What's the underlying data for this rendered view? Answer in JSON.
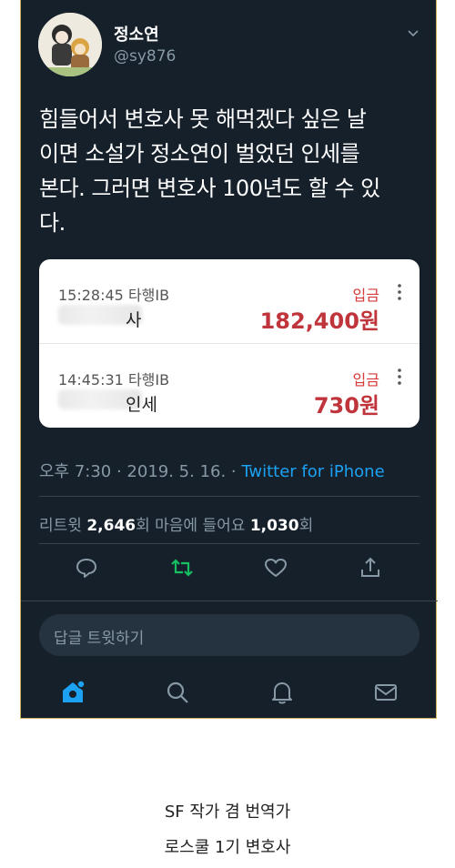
{
  "profile": {
    "display_name": "정소연",
    "handle": "@sy876"
  },
  "tweet": {
    "text": "힘들어서 변호사 못 해먹겠다 싶은 날\n이면 소설가 정소연이 벌었던 인세를\n본다. 그러면 변호사 100년도 할 수 있\n다."
  },
  "bank_card": {
    "rows": [
      {
        "time": "15:28:45 타행IB",
        "name_suffix": "사",
        "type": "입금",
        "amount": "182,400원"
      },
      {
        "time": "14:45:31 타행IB",
        "name_suffix": "인세",
        "type": "입금",
        "amount": "730원"
      }
    ]
  },
  "meta": {
    "datetime": "오후 7:30 · 2019. 5. 16. · ",
    "source": "Twitter for iPhone"
  },
  "stats": {
    "retweet_label": "리트윗 ",
    "retweet_count": "2,646",
    "retweet_unit": "회 ",
    "like_label": "마음에 들어요 ",
    "like_count": "1,030",
    "like_unit": "회"
  },
  "reply": {
    "placeholder": "답글 트윗하기"
  },
  "caption": {
    "line1": "SF 작가 겸 번역가",
    "line2": "로스쿨 1기 변호사"
  },
  "icons": {
    "reply": "reply-icon",
    "retweet": "retweet-icon",
    "like": "heart-icon",
    "share": "share-icon",
    "home": "home-icon",
    "search": "search-icon",
    "notifications": "bell-icon",
    "messages": "mail-icon"
  },
  "colors": {
    "background": "#15202b",
    "accent": "#1da1f2",
    "retweet_active": "#17bf63",
    "deposit_red": "#c0353b"
  }
}
